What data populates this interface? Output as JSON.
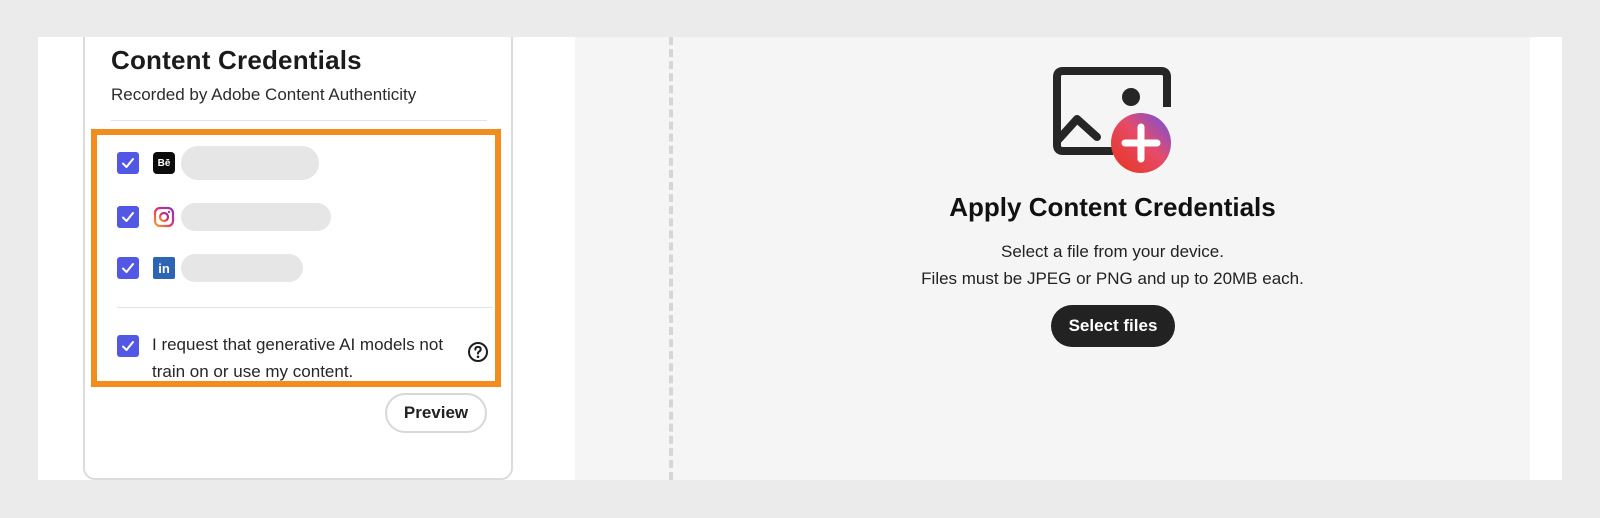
{
  "panel": {
    "title": "Content Credentials",
    "subtitle": "Recorded by Adobe Content Authenticity",
    "accounts": [
      {
        "icon": "behance-icon",
        "checked": true
      },
      {
        "icon": "instagram-icon",
        "checked": true
      },
      {
        "icon": "linkedin-icon",
        "checked": true
      }
    ],
    "ai_opt_out_label": "I request that generative AI models not train on or use my content.",
    "ai_opt_out_checked": true,
    "preview_label": "Preview",
    "behance_glyph": "Bē",
    "linkedin_glyph": "in"
  },
  "dropzone": {
    "title": "Apply Content Credentials",
    "line1": "Select a file from your device.",
    "line2": "Files must be JPEG or PNG and up to 20MB each.",
    "button_label": "Select files"
  },
  "colors": {
    "checkbox": "#5258e4",
    "highlight": "#f28c1e",
    "primary_button": "#222222"
  }
}
